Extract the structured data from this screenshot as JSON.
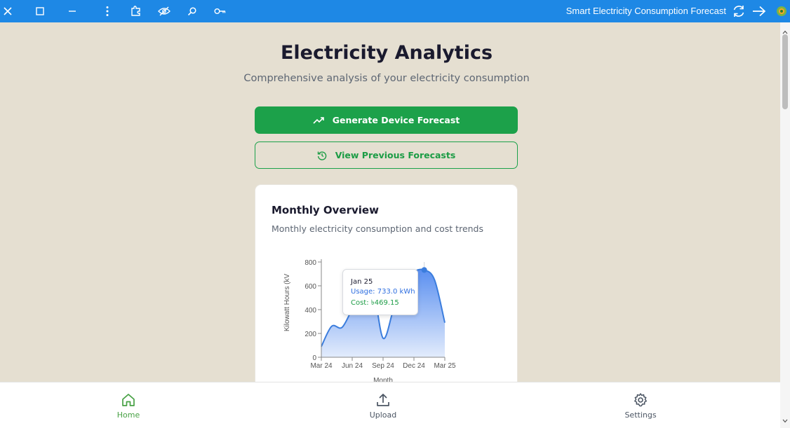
{
  "window": {
    "title": "Smart Electricity Consumption Forecast"
  },
  "page": {
    "title": "Electricity Analytics",
    "subtitle": "Comprehensive analysis of your electricity consumption"
  },
  "actions": {
    "generate_label": "Generate Device Forecast",
    "previous_label": "View Previous Forecasts"
  },
  "card": {
    "title": "Monthly Overview",
    "subtitle": "Monthly electricity consumption and cost trends"
  },
  "tooltip": {
    "month": "Jan 25",
    "usage_label": "Usage:",
    "usage_value": "733.0 kWh",
    "cost_label": "Cost:",
    "cost_value": "৳469.15"
  },
  "chart_data": {
    "type": "area",
    "ylabel": "Kilowatt Hours (kV",
    "xlabel": "Month",
    "x_ticks": [
      "Mar 24",
      "Jun 24",
      "Sep 24",
      "Dec 24",
      "Mar 25"
    ],
    "y_ticks": [
      0,
      200,
      400,
      600,
      800
    ],
    "ylim": [
      0,
      800
    ],
    "points": [
      {
        "month": "Mar 24",
        "value": 90
      },
      {
        "month": "Apr 24",
        "value": 260
      },
      {
        "month": "May 24",
        "value": 250
      },
      {
        "month": "Jun 24",
        "value": 400
      },
      {
        "month": "Jul 24",
        "value": 510
      },
      {
        "month": "Aug 24",
        "value": 580
      },
      {
        "month": "Sep 24",
        "value": 160
      },
      {
        "month": "Oct 24",
        "value": 400
      },
      {
        "month": "Nov 24",
        "value": 650
      },
      {
        "month": "Dec 24",
        "value": 720
      },
      {
        "month": "Jan 25",
        "value": 733
      },
      {
        "month": "Feb 25",
        "value": 650
      },
      {
        "month": "Mar 25",
        "value": 290
      }
    ],
    "active_point": "Jan 25",
    "colors": {
      "line": "#3b7ddd",
      "fill_top": "#5a8ff0",
      "fill_bottom": "#e3ecfc"
    }
  },
  "nav": {
    "home": "Home",
    "upload": "Upload",
    "settings": "Settings"
  },
  "colors": {
    "topbar": "#1e88e5",
    "background": "#e5dfd1",
    "primary": "#1ca14a",
    "active_nav": "#47a144"
  }
}
